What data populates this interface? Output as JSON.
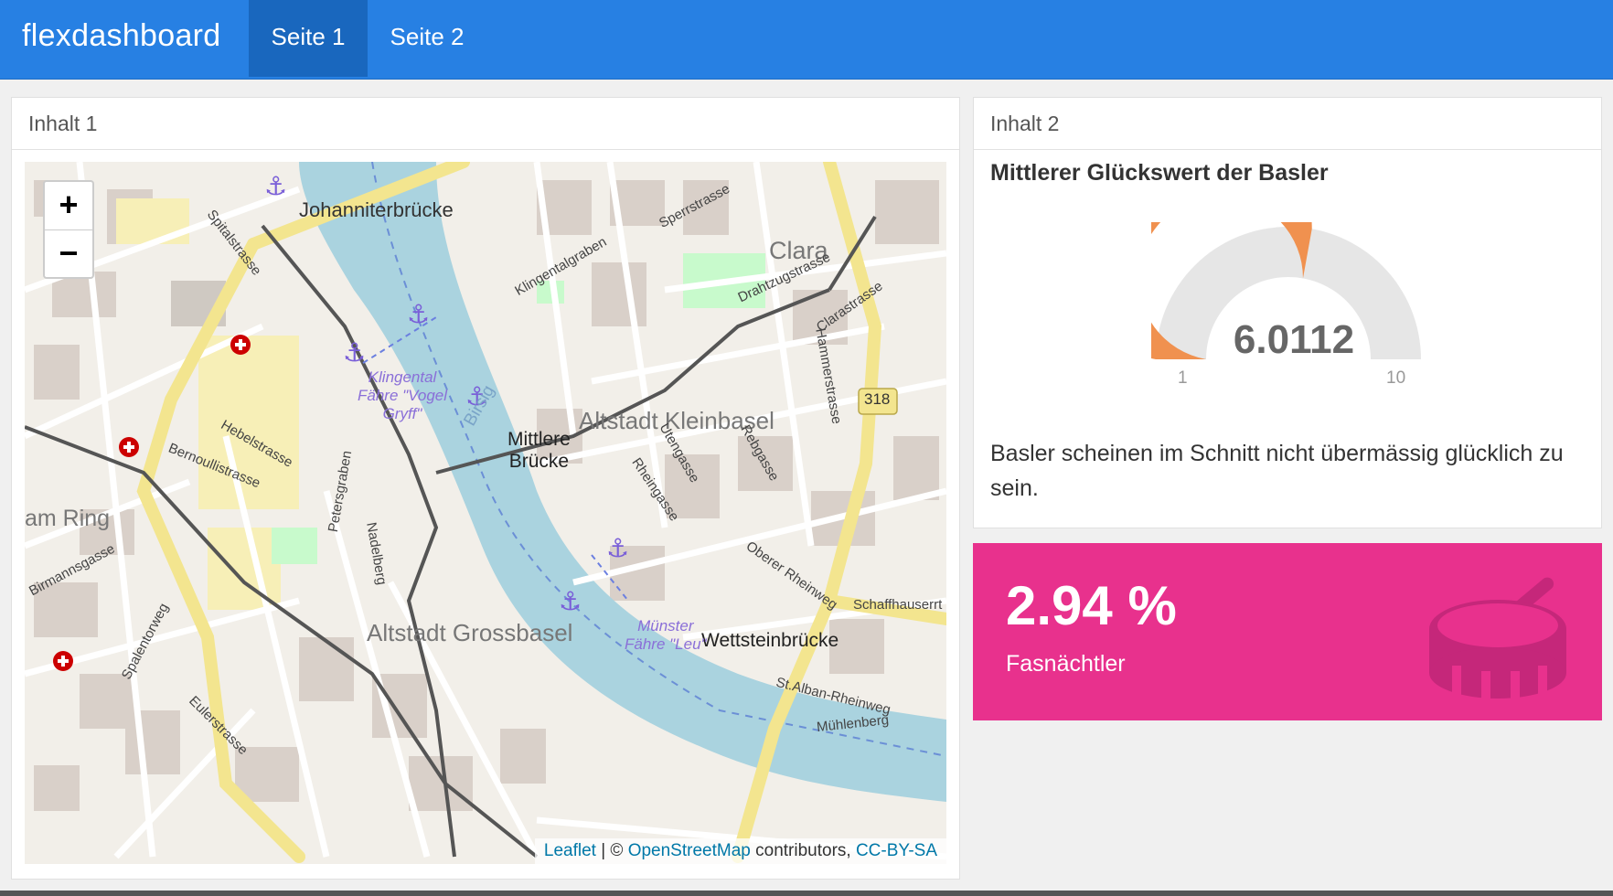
{
  "navbar": {
    "brand": "flexdashboard",
    "tabs": [
      {
        "label": "Seite 1",
        "active": true
      },
      {
        "label": "Seite 2",
        "active": false
      }
    ],
    "color": "#2780e3"
  },
  "map_card": {
    "title": "Inhalt 1",
    "zoom_in": "+",
    "zoom_out": "−",
    "labels": {
      "johanniterbruecke": "Johanniterbrücke",
      "mittlere": "Mittlere",
      "bruecke": "Brücke",
      "kleinbasel": "Altstadt Kleinbasel",
      "grossbasel": "Altstadt Grossbasel",
      "wettsteinbruecke": "Wettsteinbrücke",
      "clara": "Clara",
      "am_ring": "am Ring",
      "birsig": "Birsig",
      "klingental_1": "Klingental",
      "klingental_2": "Fähre \"Vogel",
      "klingental_3": "Gryff\"",
      "muenster_1": "Münster",
      "muenster_2": "Fähre \"Leu\"",
      "route_318": "318",
      "spitalstrasse": "Spitalstrasse",
      "hebelstrasse": "Hebelstrasse",
      "bernoullistrasse": "Bernoullistrasse",
      "petersgraben": "Petersgraben",
      "nadelberg": "Nadelberg",
      "rheingasse": "Rheingasse",
      "utengasse": "Utengasse",
      "rebgasse": "Rebgasse",
      "klingentalgraben": "Klingentalgraben",
      "drahtzugstrasse": "Drahtzugstrasse",
      "clarastrasse": "Clarastrasse",
      "hammerstrasse": "Hammerstrasse",
      "oberer_rheinweg": "Oberer Rheinweg",
      "st_alban_rheinweg": "St.Alban-Rheinweg",
      "muehlenberg": "Mühlenberg",
      "eulerstrasse": "Eulerstrasse",
      "birmannsgasse": "Birmannsgasse",
      "spalentorweg": "Spalentorweg",
      "schaffhauserr": "Schaffhauserrt",
      "sperrstrasse": "Sperrstrasse"
    },
    "attribution": {
      "leaflet": "Leaflet",
      "sep": " | © ",
      "osm": "OpenStreetMap",
      "contrib": " contributors, ",
      "license": "CC-BY-SA"
    }
  },
  "gauge_card": {
    "title": "Inhalt 2",
    "heading": "Mittlerer Glückswert der Basler",
    "value": "6.0112",
    "min": "1",
    "max": "10",
    "fraction": 0.5568,
    "fill_color": "#f0914f",
    "track_color": "#e6e6e6",
    "text": "Basler scheinen im Schnitt nicht übermässig glücklich zu sein."
  },
  "value_box": {
    "value": "2.94 %",
    "caption": "Fasnächtler",
    "icon": "drum-icon",
    "color": "#e8318d"
  }
}
